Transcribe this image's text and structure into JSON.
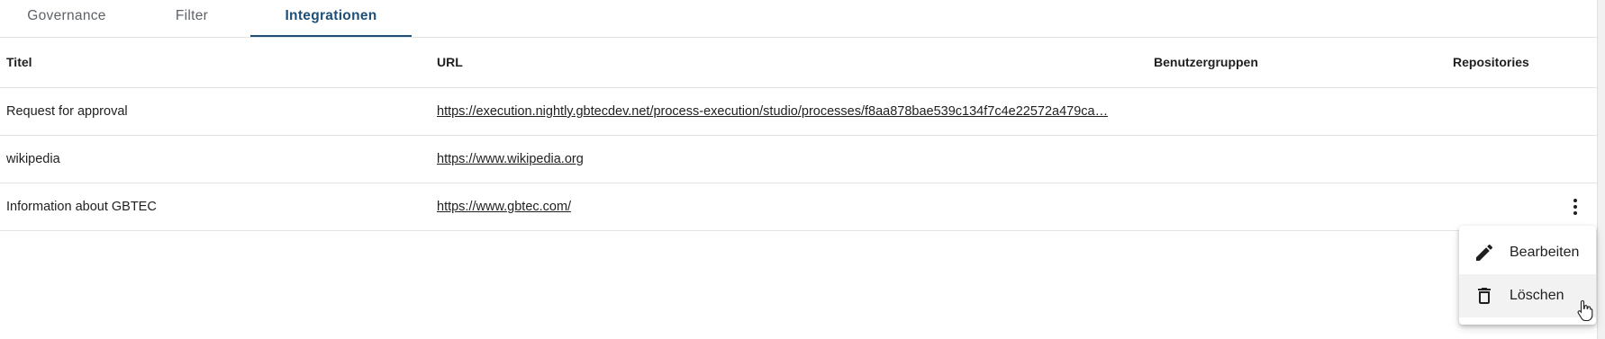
{
  "tabs": [
    {
      "label": "Governance",
      "active": false
    },
    {
      "label": "Filter",
      "active": false
    },
    {
      "label": "Integrationen",
      "active": true
    }
  ],
  "accent_color": "#1d4f78",
  "table": {
    "headers": {
      "title": "Titel",
      "url": "URL",
      "groups": "Benutzergruppen",
      "repos": "Repositories"
    },
    "rows": [
      {
        "title": "Request for approval",
        "url": "https://execution.nightly.gbtecdev.net/process-execution/studio/processes/f8aa878bae539c134f7c4e22572a479ca…",
        "groups": "",
        "repos": ""
      },
      {
        "title": "wikipedia",
        "url": "https://www.wikipedia.org",
        "groups": "",
        "repos": ""
      },
      {
        "title": "Information about GBTEC",
        "url": "https://www.gbtec.com/",
        "groups": "",
        "repos": ""
      }
    ]
  },
  "row_actions_icon": "more-vert-icon",
  "context_menu": {
    "items": [
      {
        "label": "Bearbeiten",
        "icon": "pencil-icon"
      },
      {
        "label": "Löschen",
        "icon": "trash-icon"
      }
    ]
  }
}
